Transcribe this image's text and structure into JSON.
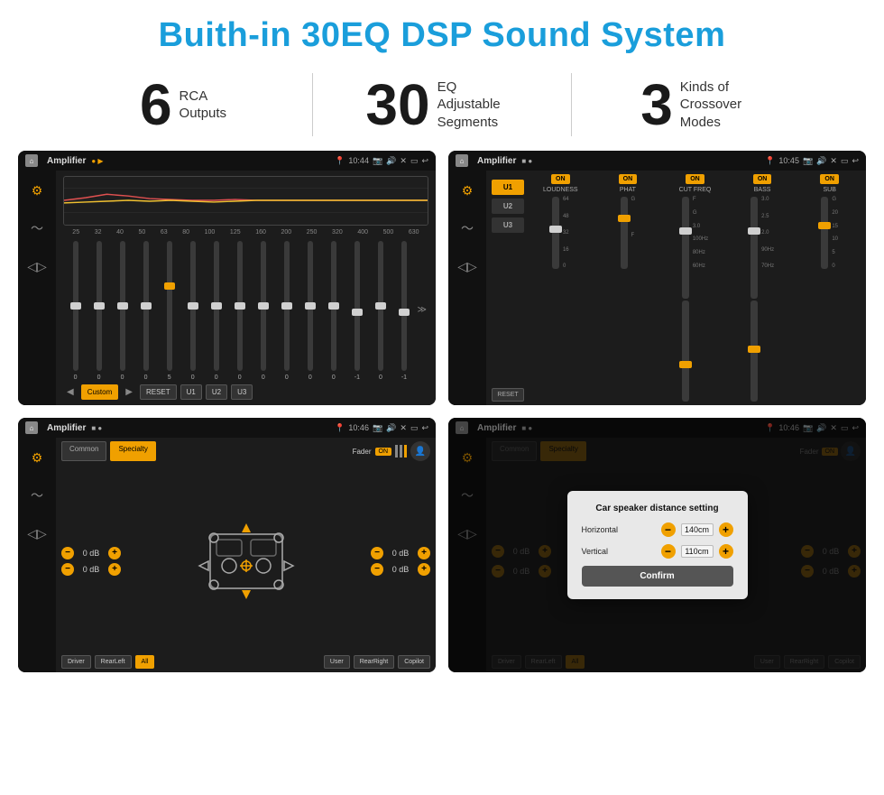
{
  "page": {
    "title": "Buith-in 30EQ DSP Sound System"
  },
  "stats": [
    {
      "number": "6",
      "label": "RCA\nOutputs"
    },
    {
      "number": "30",
      "label": "EQ Adjustable\nSegments"
    },
    {
      "number": "3",
      "label": "Kinds of\nCrossover Modes"
    }
  ],
  "screens": [
    {
      "id": "screen1",
      "statusBar": {
        "title": "Amplifier",
        "time": "10:44"
      },
      "type": "eq"
    },
    {
      "id": "screen2",
      "statusBar": {
        "title": "Amplifier",
        "time": "10:45"
      },
      "type": "crossover"
    },
    {
      "id": "screen3",
      "statusBar": {
        "title": "Amplifier",
        "time": "10:46"
      },
      "type": "fader"
    },
    {
      "id": "screen4",
      "statusBar": {
        "title": "Amplifier",
        "time": "10:46"
      },
      "type": "distance"
    }
  ],
  "eq": {
    "freqs": [
      "25",
      "32",
      "40",
      "50",
      "63",
      "80",
      "100",
      "125",
      "160",
      "200",
      "250",
      "320",
      "400",
      "500",
      "630"
    ],
    "values": [
      "0",
      "0",
      "0",
      "0",
      "5",
      "0",
      "0",
      "0",
      "0",
      "0",
      "0",
      "0",
      "-1",
      "0",
      "-1"
    ],
    "presets": [
      "Custom",
      "RESET",
      "U1",
      "U2",
      "U3"
    ],
    "currentPreset": "Custom"
  },
  "crossover": {
    "presets": [
      "U1",
      "U2",
      "U3"
    ],
    "controls": [
      {
        "label": "LOUDNESS",
        "toggle": "ON"
      },
      {
        "label": "PHAT",
        "toggle": "ON"
      },
      {
        "label": "CUT FREQ",
        "toggle": "ON"
      },
      {
        "label": "BASS",
        "toggle": "ON"
      },
      {
        "label": "SUB",
        "toggle": "ON"
      }
    ]
  },
  "fader": {
    "tabs": [
      "Common",
      "Specialty"
    ],
    "activeTab": "Specialty",
    "faderLabel": "Fader",
    "faderToggle": "ON",
    "positions": [
      {
        "label": "",
        "value": "0 dB"
      },
      {
        "label": "",
        "value": "0 dB"
      },
      {
        "label": "",
        "value": "0 dB"
      },
      {
        "label": "",
        "value": "0 dB"
      }
    ],
    "bottomBtns": [
      "Driver",
      "RearLeft",
      "All",
      "User",
      "RearRight",
      "Copilot"
    ]
  },
  "dialog": {
    "title": "Car speaker distance setting",
    "fields": [
      {
        "label": "Horizontal",
        "value": "140cm"
      },
      {
        "label": "Vertical",
        "value": "110cm"
      }
    ],
    "confirmLabel": "Confirm"
  }
}
